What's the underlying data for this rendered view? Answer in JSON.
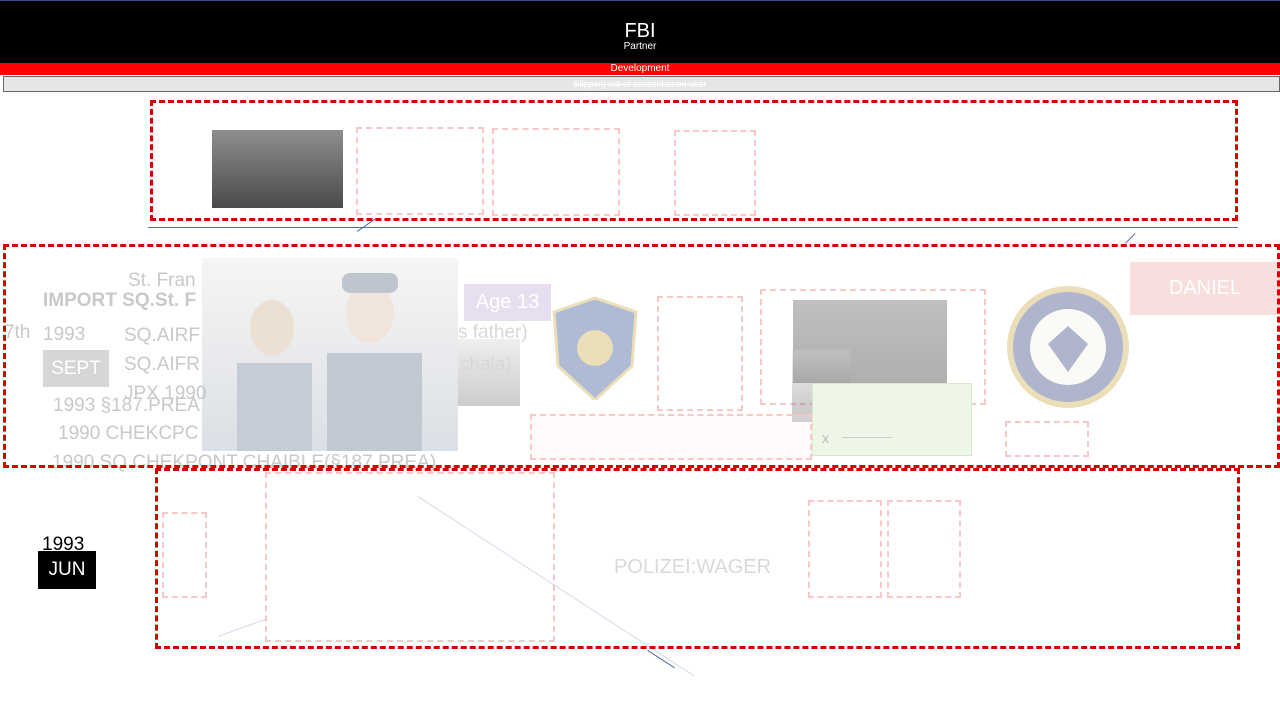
{
  "header": {
    "title": "FBI",
    "subtitle": "Partner",
    "band_label": "Development",
    "strip_label": "Slipping out of sactionhonon user"
  },
  "middle": {
    "ghost_lines": [
      "St. Fran",
      "IMPORT SQ.St. F",
      "7th",
      "1993",
      "SQ.AIRF",
      "SQ.AIFR",
      "JPX 1990",
      "1993 §187.PREA",
      "1990 CHEKCPC",
      "1990 SQ.CHEKPONT CHAIBLE(§187.PREA)"
    ],
    "sept": "SEPT",
    "age": "Age 13",
    "father": "s father)",
    "chala": "chala)",
    "x_mark": "x",
    "daniel": "DANIEL",
    "police_badge": "FOSTER CITY POLICE",
    "navy_seal": "UNITED STATES NAVY"
  },
  "bottom": {
    "year": "1993",
    "month": "JUN",
    "wager": "POLIZEI:WAGER"
  },
  "colors": {
    "header_bg": "#000000",
    "band_bg": "#ff0000",
    "dash_red": "#d60000",
    "connector": "#4d6ea8"
  }
}
